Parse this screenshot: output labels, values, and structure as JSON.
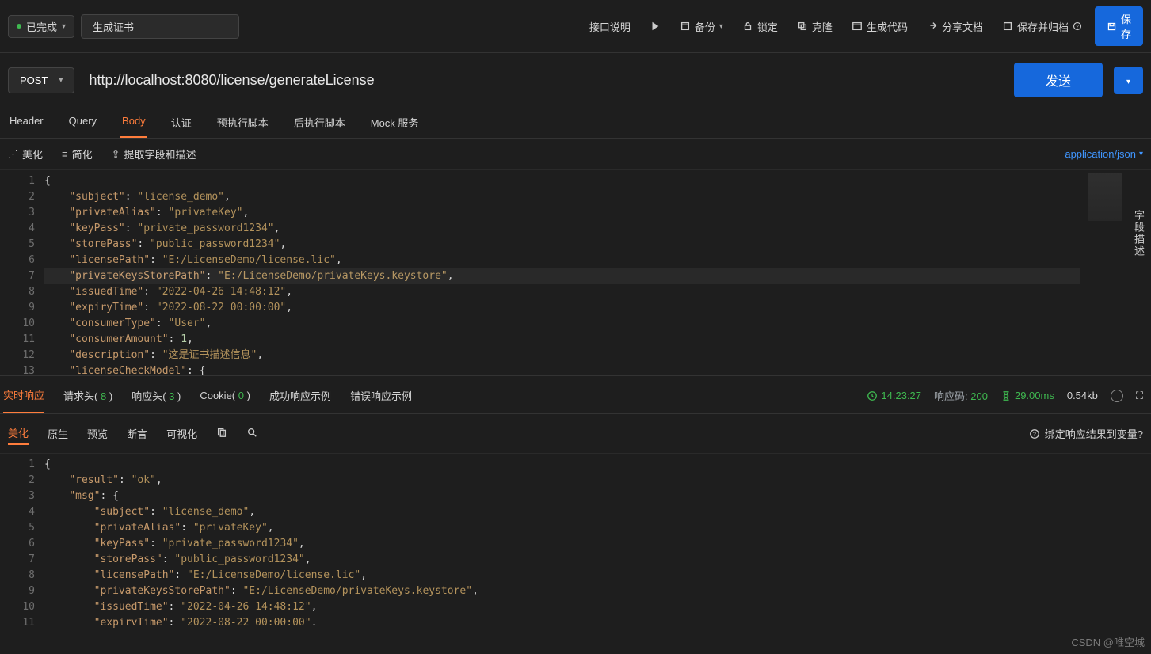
{
  "top": {
    "status": "已完成",
    "tabName": "生成证书",
    "apiDoc": "接口说明",
    "backup": "备份",
    "lock": "锁定",
    "clone": "克隆",
    "genCode": "生成代码",
    "shareDoc": "分享文档",
    "saveArchive": "保存并归档",
    "save": "保存"
  },
  "request": {
    "method": "POST",
    "url": "http://localhost:8080/license/generateLicense",
    "send": "发送"
  },
  "reqTabs": [
    "Header",
    "Query",
    "Body",
    "认证",
    "预执行脚本",
    "后执行脚本",
    "Mock 服务"
  ],
  "reqActiveTab": 2,
  "bodyTools": {
    "beautify": "美化",
    "simplify": "简化",
    "extract": "提取字段和描述",
    "contentType": "application/json"
  },
  "sideLabel": "字段描述",
  "bodyLines": [
    [
      {
        "t": "p",
        "v": "{"
      }
    ],
    [
      {
        "t": "p",
        "v": "    "
      },
      {
        "t": "k",
        "v": "\"subject\""
      },
      {
        "t": "p",
        "v": ": "
      },
      {
        "t": "s",
        "v": "\"license_demo\""
      },
      {
        "t": "p",
        "v": ","
      }
    ],
    [
      {
        "t": "p",
        "v": "    "
      },
      {
        "t": "k",
        "v": "\"privateAlias\""
      },
      {
        "t": "p",
        "v": ": "
      },
      {
        "t": "s",
        "v": "\"privateKey\""
      },
      {
        "t": "p",
        "v": ","
      }
    ],
    [
      {
        "t": "p",
        "v": "    "
      },
      {
        "t": "k",
        "v": "\"keyPass\""
      },
      {
        "t": "p",
        "v": ": "
      },
      {
        "t": "s",
        "v": "\"private_password1234\""
      },
      {
        "t": "p",
        "v": ","
      }
    ],
    [
      {
        "t": "p",
        "v": "    "
      },
      {
        "t": "k",
        "v": "\"storePass\""
      },
      {
        "t": "p",
        "v": ": "
      },
      {
        "t": "s",
        "v": "\"public_password1234\""
      },
      {
        "t": "p",
        "v": ","
      }
    ],
    [
      {
        "t": "p",
        "v": "    "
      },
      {
        "t": "k",
        "v": "\"licensePath\""
      },
      {
        "t": "p",
        "v": ": "
      },
      {
        "t": "s",
        "v": "\"E:/LicenseDemo/license.lic\""
      },
      {
        "t": "p",
        "v": ","
      }
    ],
    [
      {
        "t": "p",
        "v": "    "
      },
      {
        "t": "k",
        "v": "\"privateKeysStorePath\""
      },
      {
        "t": "p",
        "v": ": "
      },
      {
        "t": "s",
        "v": "\"E:/LicenseDemo/privateKeys.keystore\""
      },
      {
        "t": "p",
        "v": ","
      }
    ],
    [
      {
        "t": "p",
        "v": "    "
      },
      {
        "t": "k",
        "v": "\"issuedTime\""
      },
      {
        "t": "p",
        "v": ": "
      },
      {
        "t": "s",
        "v": "\"2022-04-26 14:48:12\""
      },
      {
        "t": "p",
        "v": ","
      }
    ],
    [
      {
        "t": "p",
        "v": "    "
      },
      {
        "t": "k",
        "v": "\"expiryTime\""
      },
      {
        "t": "p",
        "v": ": "
      },
      {
        "t": "s",
        "v": "\"2022-08-22 00:00:00\""
      },
      {
        "t": "p",
        "v": ","
      }
    ],
    [
      {
        "t": "p",
        "v": "    "
      },
      {
        "t": "k",
        "v": "\"consumerType\""
      },
      {
        "t": "p",
        "v": ": "
      },
      {
        "t": "s",
        "v": "\"User\""
      },
      {
        "t": "p",
        "v": ","
      }
    ],
    [
      {
        "t": "p",
        "v": "    "
      },
      {
        "t": "k",
        "v": "\"consumerAmount\""
      },
      {
        "t": "p",
        "v": ": "
      },
      {
        "t": "n",
        "v": "1"
      },
      {
        "t": "p",
        "v": ","
      }
    ],
    [
      {
        "t": "p",
        "v": "    "
      },
      {
        "t": "k",
        "v": "\"description\""
      },
      {
        "t": "p",
        "v": ": "
      },
      {
        "t": "s",
        "v": "\"这是证书描述信息\""
      },
      {
        "t": "p",
        "v": ","
      }
    ],
    [
      {
        "t": "p",
        "v": "    "
      },
      {
        "t": "k",
        "v": "\"licenseCheckModel\""
      },
      {
        "t": "p",
        "v": ": {"
      }
    ]
  ],
  "respTabs": {
    "realtime": "实时响应",
    "reqHeaders": "请求头",
    "reqHeadersCount": "8",
    "respHeaders": "响应头",
    "respHeadersCount": "3",
    "cookie": "Cookie",
    "cookieCount": "0",
    "successEx": "成功响应示例",
    "errorEx": "错误响应示例"
  },
  "respMeta": {
    "time": "14:23:27",
    "codeLabel": "响应码:",
    "code": "200",
    "duration": "29.00ms",
    "size": "0.54kb"
  },
  "respTools": [
    "美化",
    "原生",
    "预览",
    "断言",
    "可视化"
  ],
  "respBind": "绑定响应结果到变量?",
  "respLines": [
    [
      {
        "t": "p",
        "v": "{"
      }
    ],
    [
      {
        "t": "p",
        "v": "    "
      },
      {
        "t": "k",
        "v": "\"result\""
      },
      {
        "t": "p",
        "v": ": "
      },
      {
        "t": "s",
        "v": "\"ok\""
      },
      {
        "t": "p",
        "v": ","
      }
    ],
    [
      {
        "t": "p",
        "v": "    "
      },
      {
        "t": "k",
        "v": "\"msg\""
      },
      {
        "t": "p",
        "v": ": {"
      }
    ],
    [
      {
        "t": "p",
        "v": "        "
      },
      {
        "t": "k",
        "v": "\"subject\""
      },
      {
        "t": "p",
        "v": ": "
      },
      {
        "t": "s",
        "v": "\"license_demo\""
      },
      {
        "t": "p",
        "v": ","
      }
    ],
    [
      {
        "t": "p",
        "v": "        "
      },
      {
        "t": "k",
        "v": "\"privateAlias\""
      },
      {
        "t": "p",
        "v": ": "
      },
      {
        "t": "s",
        "v": "\"privateKey\""
      },
      {
        "t": "p",
        "v": ","
      }
    ],
    [
      {
        "t": "p",
        "v": "        "
      },
      {
        "t": "k",
        "v": "\"keyPass\""
      },
      {
        "t": "p",
        "v": ": "
      },
      {
        "t": "s",
        "v": "\"private_password1234\""
      },
      {
        "t": "p",
        "v": ","
      }
    ],
    [
      {
        "t": "p",
        "v": "        "
      },
      {
        "t": "k",
        "v": "\"storePass\""
      },
      {
        "t": "p",
        "v": ": "
      },
      {
        "t": "s",
        "v": "\"public_password1234\""
      },
      {
        "t": "p",
        "v": ","
      }
    ],
    [
      {
        "t": "p",
        "v": "        "
      },
      {
        "t": "k",
        "v": "\"licensePath\""
      },
      {
        "t": "p",
        "v": ": "
      },
      {
        "t": "s",
        "v": "\"E:/LicenseDemo/license.lic\""
      },
      {
        "t": "p",
        "v": ","
      }
    ],
    [
      {
        "t": "p",
        "v": "        "
      },
      {
        "t": "k",
        "v": "\"privateKeysStorePath\""
      },
      {
        "t": "p",
        "v": ": "
      },
      {
        "t": "s",
        "v": "\"E:/LicenseDemo/privateKeys.keystore\""
      },
      {
        "t": "p",
        "v": ","
      }
    ],
    [
      {
        "t": "p",
        "v": "        "
      },
      {
        "t": "k",
        "v": "\"issuedTime\""
      },
      {
        "t": "p",
        "v": ": "
      },
      {
        "t": "s",
        "v": "\"2022-04-26 14:48:12\""
      },
      {
        "t": "p",
        "v": ","
      }
    ],
    [
      {
        "t": "p",
        "v": "        "
      },
      {
        "t": "k",
        "v": "\"expirvTime\""
      },
      {
        "t": "p",
        "v": ": "
      },
      {
        "t": "s",
        "v": "\"2022-08-22 00:00:00\""
      },
      {
        "t": "p",
        "v": "."
      }
    ]
  ],
  "watermark": "CSDN @唯空城"
}
